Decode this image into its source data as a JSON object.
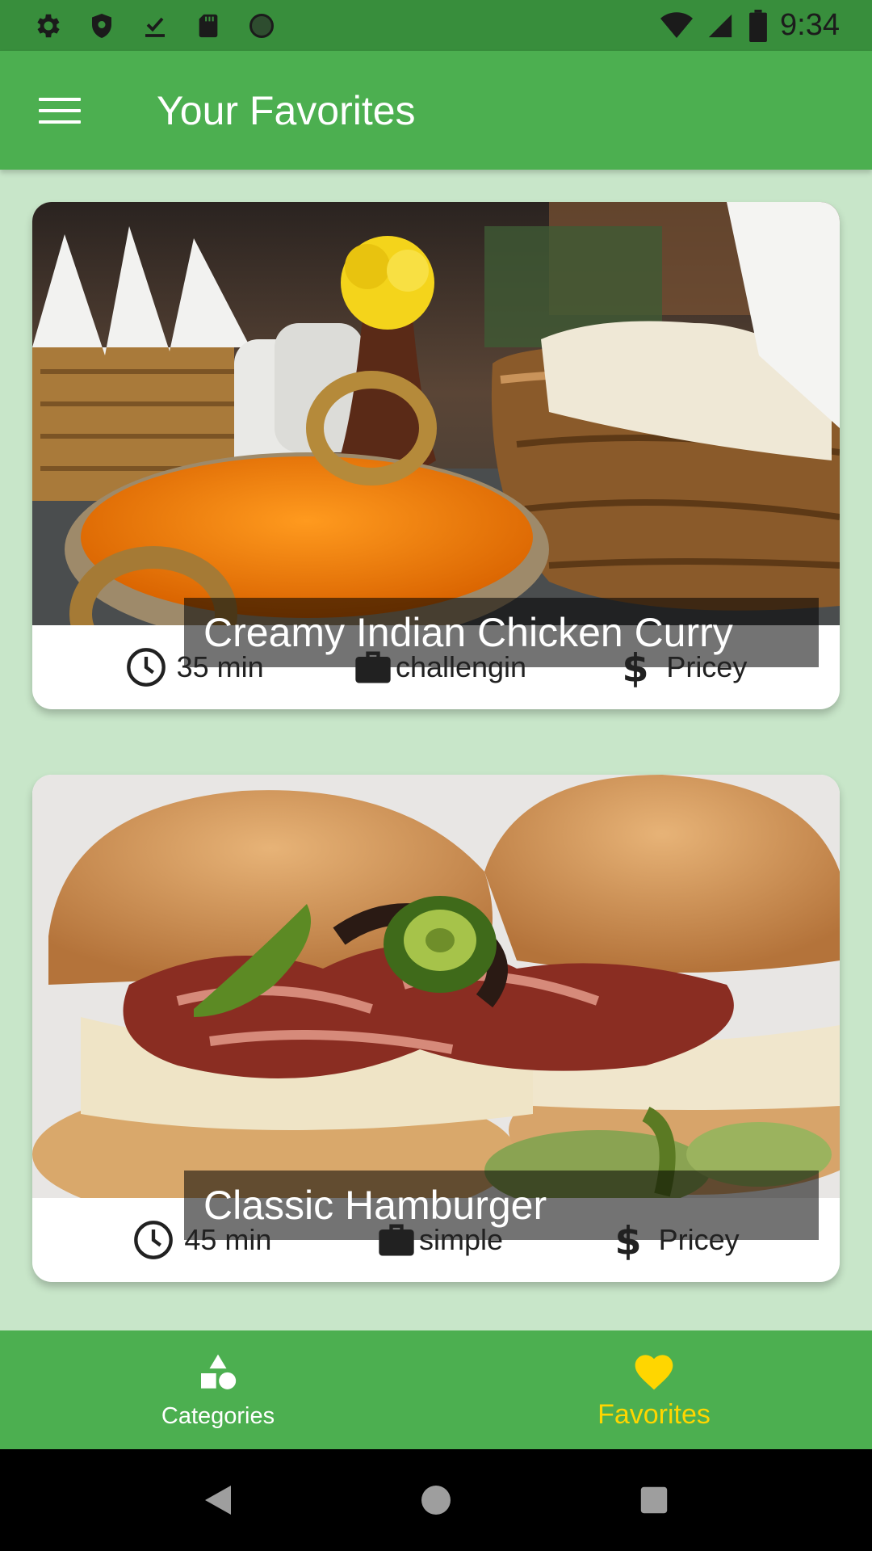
{
  "status_bar": {
    "time": "9:34",
    "left_icons": [
      "settings-icon",
      "shield-icon",
      "check-download-icon",
      "sd-card-icon",
      "circle-icon"
    ],
    "right_icons": [
      "wifi-icon",
      "signal-icon",
      "battery-icon"
    ]
  },
  "app_bar": {
    "title": "Your Favorites",
    "menu_icon": "menu-icon"
  },
  "meals": [
    {
      "title": "Creamy Indian Chicken Curry",
      "duration": "35 min",
      "complexity": "challengin",
      "affordability": "Pricey"
    },
    {
      "title": "Classic Hamburger",
      "duration": "45 min",
      "complexity": "simple",
      "affordability": "Pricey"
    }
  ],
  "bottom_nav": {
    "items": [
      {
        "label": "Categories",
        "icon": "category-shapes-icon",
        "active": false
      },
      {
        "label": "Favorites",
        "icon": "heart-icon",
        "active": true
      }
    ]
  },
  "colors": {
    "primary": "#4CAF50",
    "primary_dark": "#388E3C",
    "background": "#C8E6C9",
    "accent": "#FFD600"
  },
  "system_nav": [
    "back-icon",
    "home-icon",
    "recents-icon"
  ]
}
